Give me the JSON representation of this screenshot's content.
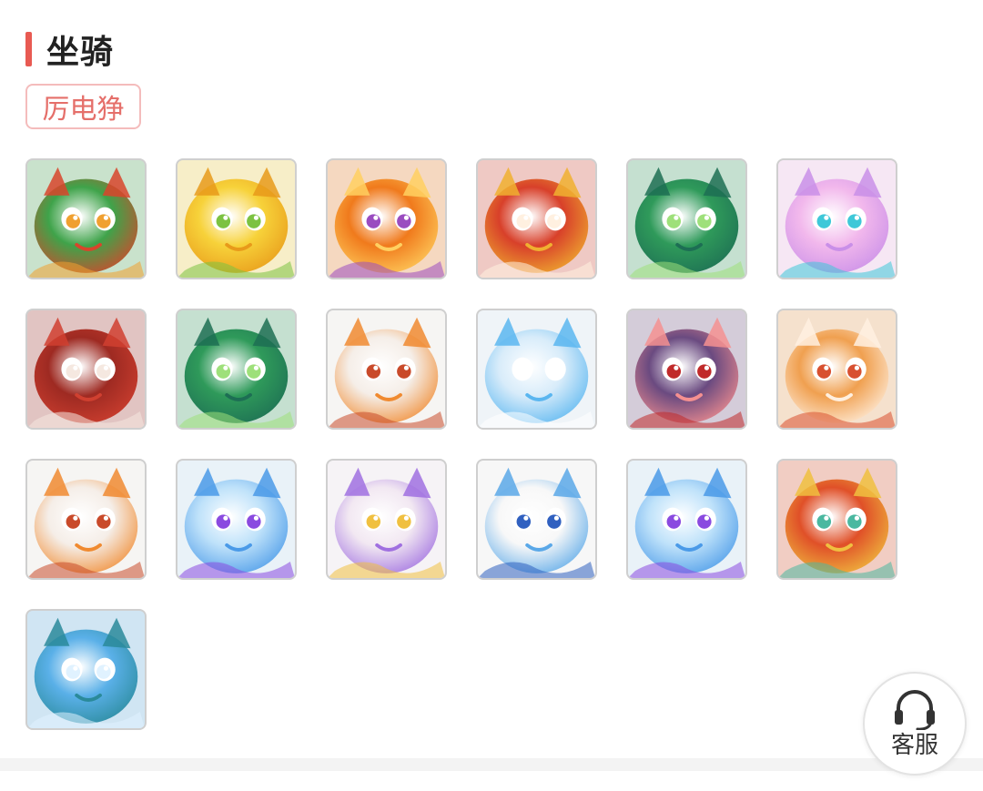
{
  "section": {
    "title": "坐骑",
    "tag": "厉电狰"
  },
  "mounts": [
    {
      "icon": "green-red-dragon-lion-icon",
      "colors": [
        "#3fa34a",
        "#d8452b",
        "#f0a030"
      ]
    },
    {
      "icon": "yellow-fruit-creature-icon",
      "colors": [
        "#f7d23a",
        "#e89a1a",
        "#7cc242"
      ]
    },
    {
      "icon": "orange-goldfish-icon",
      "colors": [
        "#f07a1c",
        "#ffd060",
        "#9a4cc0"
      ]
    },
    {
      "icon": "golden-red-dragon-icon",
      "colors": [
        "#d8402a",
        "#f0b030",
        "#fff0e0"
      ]
    },
    {
      "icon": "green-jade-dragon-icon",
      "colors": [
        "#2f9a5a",
        "#1d6e54",
        "#9ee07a"
      ]
    },
    {
      "icon": "pink-deer-icon",
      "colors": [
        "#f2b8ec",
        "#c98fe8",
        "#3ec8d8"
      ]
    },
    {
      "icon": "red-beetle-icon",
      "colors": [
        "#9e2a22",
        "#d04030",
        "#f5e8e0"
      ]
    },
    {
      "icon": "green-jade-dragon-icon",
      "colors": [
        "#2f9a5a",
        "#1d6e54",
        "#9ee07a"
      ]
    },
    {
      "icon": "white-rabbit-icon",
      "colors": [
        "#f5eee8",
        "#f08a30",
        "#c94a2a"
      ]
    },
    {
      "icon": "ice-skull-dragon-icon",
      "colors": [
        "#d8ecfa",
        "#5ab6f0",
        "#ffffff"
      ]
    },
    {
      "icon": "purple-pig-icon",
      "colors": [
        "#6a4a80",
        "#f59090",
        "#c02a2a"
      ]
    },
    {
      "icon": "orange-fox-icon",
      "colors": [
        "#f0a050",
        "#fff0e0",
        "#d85030"
      ]
    },
    {
      "icon": "white-rabbit-icon",
      "colors": [
        "#f5eee8",
        "#f08a30",
        "#c94a2a"
      ]
    },
    {
      "icon": "blue-cat-icon",
      "colors": [
        "#bfe2fa",
        "#4a9ae8",
        "#8a4ae0"
      ]
    },
    {
      "icon": "purple-unicorn-icon",
      "colors": [
        "#f2e8f2",
        "#a070e0",
        "#f0c040"
      ]
    },
    {
      "icon": "white-cat-icon",
      "colors": [
        "#f8f8f8",
        "#5aa8e8",
        "#3060c0"
      ]
    },
    {
      "icon": "blue-cat-icon",
      "colors": [
        "#bfe2fa",
        "#4a9ae8",
        "#8a4ae0"
      ]
    },
    {
      "icon": "red-fox-icon",
      "colors": [
        "#e05028",
        "#f0c040",
        "#4ab8a0"
      ]
    },
    {
      "icon": "blue-beast-icon",
      "colors": [
        "#5ab0e8",
        "#2a8a9a",
        "#e0f2ff"
      ]
    }
  ],
  "service": {
    "label": "客服",
    "icon": "headset-icon"
  }
}
